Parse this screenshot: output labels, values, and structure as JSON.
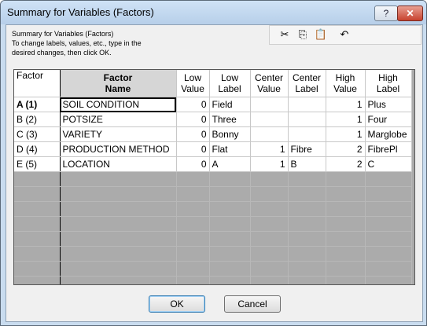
{
  "window": {
    "title": "Summary for Variables (Factors)",
    "help_label": "?",
    "close_label": "✕"
  },
  "description": {
    "line1": "Summary for Variables (Factors)",
    "line2": "To change labels, values, etc., type in the",
    "line3": "desired changes, then click OK."
  },
  "toolbar": {
    "cut_icon": "✂",
    "copy_icon": "⎘",
    "paste_icon": "📋",
    "undo_icon": "↶"
  },
  "table": {
    "headers": {
      "factor": "Factor",
      "name_l1": "Factor",
      "name_l2": "Name",
      "low_value_l1": "Low",
      "low_value_l2": "Value",
      "low_label_l1": "Low",
      "low_label_l2": "Label",
      "center_value_l1": "Center",
      "center_value_l2": "Value",
      "center_label_l1": "Center",
      "center_label_l2": "Label",
      "high_value_l1": "High",
      "high_value_l2": "Value",
      "high_label_l1": "High",
      "high_label_l2": "Label"
    },
    "rows": [
      {
        "factor": "A  (1)",
        "name": "SOIL CONDITION",
        "low_value": "0",
        "low_label": "Field",
        "center_value": "",
        "center_label": "",
        "high_value": "1",
        "high_label": "Plus"
      },
      {
        "factor": "B  (2)",
        "name": "POTSIZE",
        "low_value": "0",
        "low_label": "Three",
        "center_value": "",
        "center_label": "",
        "high_value": "1",
        "high_label": "Four"
      },
      {
        "factor": "C  (3)",
        "name": "VARIETY",
        "low_value": "0",
        "low_label": "Bonny",
        "center_value": "",
        "center_label": "",
        "high_value": "1",
        "high_label": "Marglobe"
      },
      {
        "factor": "D  (4)",
        "name": "PRODUCTION METHOD",
        "low_value": "0",
        "low_label": "Flat",
        "center_value": "1",
        "center_label": "Fibre",
        "high_value": "2",
        "high_label": "FibrePl"
      },
      {
        "factor": "E  (5)",
        "name": "LOCATION",
        "low_value": "0",
        "low_label": "A",
        "center_value": "1",
        "center_label": "B",
        "high_value": "2",
        "high_label": "C"
      }
    ]
  },
  "buttons": {
    "ok": "OK",
    "cancel": "Cancel"
  }
}
